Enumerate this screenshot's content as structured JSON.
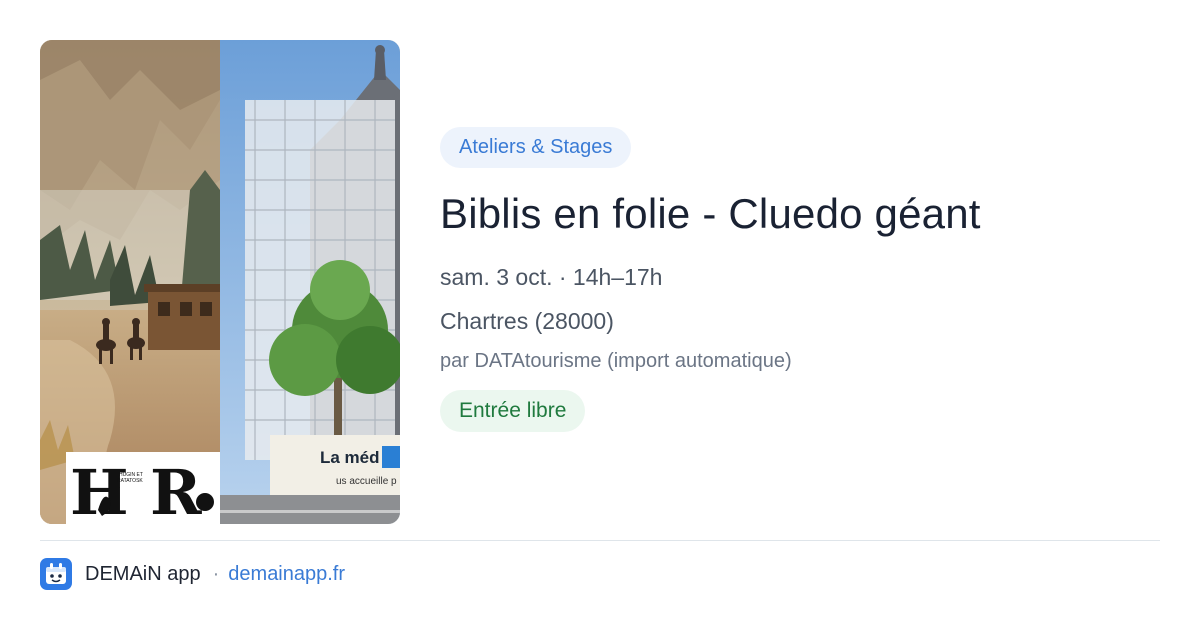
{
  "event": {
    "category": "Ateliers & Stages",
    "title": "Biblis en folie - Cluedo géant",
    "datetime": "sam. 3 oct. · 14h–17h",
    "location": "Chartres (28000)",
    "source": "par DATAtourisme (import automatique)",
    "price": "Entrée libre",
    "image": {
      "description_icon": "event-photo",
      "sign_text_part1": "La méd",
      "sign_text_part2": "us accueille p",
      "logo_small_text_1": "HUGIN ET",
      "logo_small_text_2": "RATATOSK"
    }
  },
  "footer": {
    "app_name": "DEMAiN app",
    "separator": "·",
    "url": "demainapp.fr"
  },
  "colors": {
    "accent": "#3a7bd5",
    "category_bg": "#edf3fc",
    "price_text": "#1f7a3e",
    "price_bg": "#ebf7ef",
    "title": "#1a2233"
  }
}
